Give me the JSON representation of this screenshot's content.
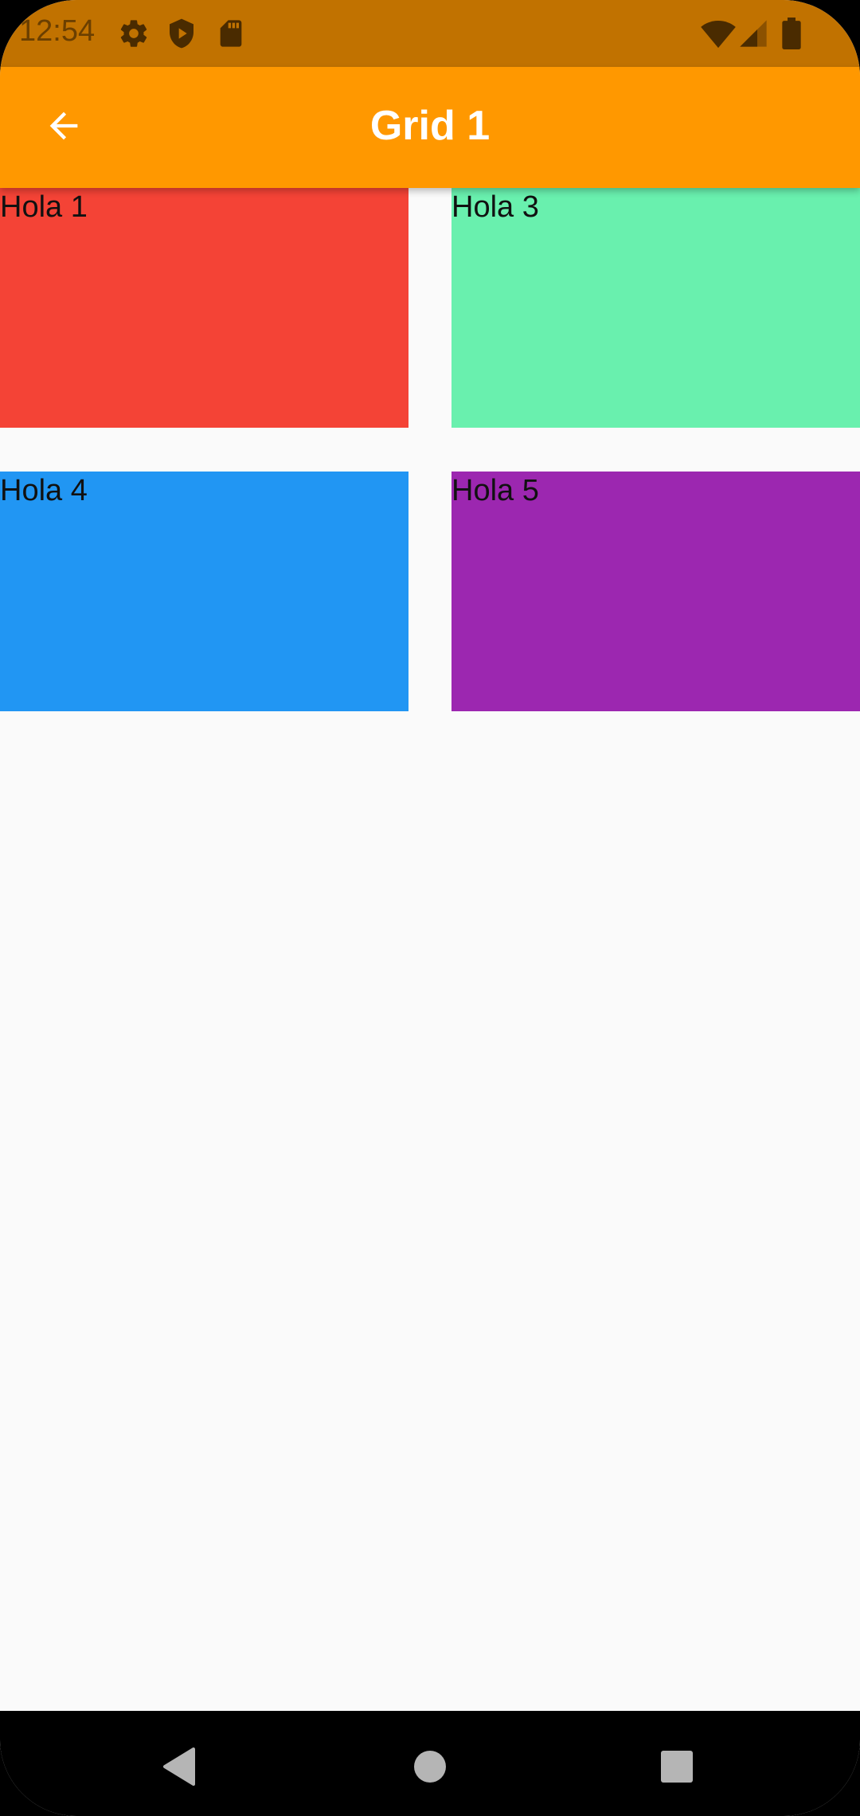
{
  "status_bar": {
    "time": "12:54",
    "icons": [
      "gear-icon",
      "shield-icon",
      "sd-card-icon",
      "wifi-icon",
      "signal-icon",
      "battery-icon"
    ],
    "color": "#c17200"
  },
  "app_bar": {
    "title": "Grid 1",
    "back_icon": "arrow-left-icon",
    "color": "#ff9800"
  },
  "grid": {
    "tiles": [
      {
        "label": "Hola 1",
        "color": "#f44336"
      },
      {
        "label": "Hola 3",
        "color": "#69f0ae"
      },
      {
        "label": "Hola 4",
        "color": "#2196f3"
      },
      {
        "label": "Hola 5",
        "color": "#9c27b0"
      }
    ]
  },
  "nav_bar": {
    "icons": [
      "back-triangle-icon",
      "home-circle-icon",
      "recents-square-icon"
    ]
  }
}
